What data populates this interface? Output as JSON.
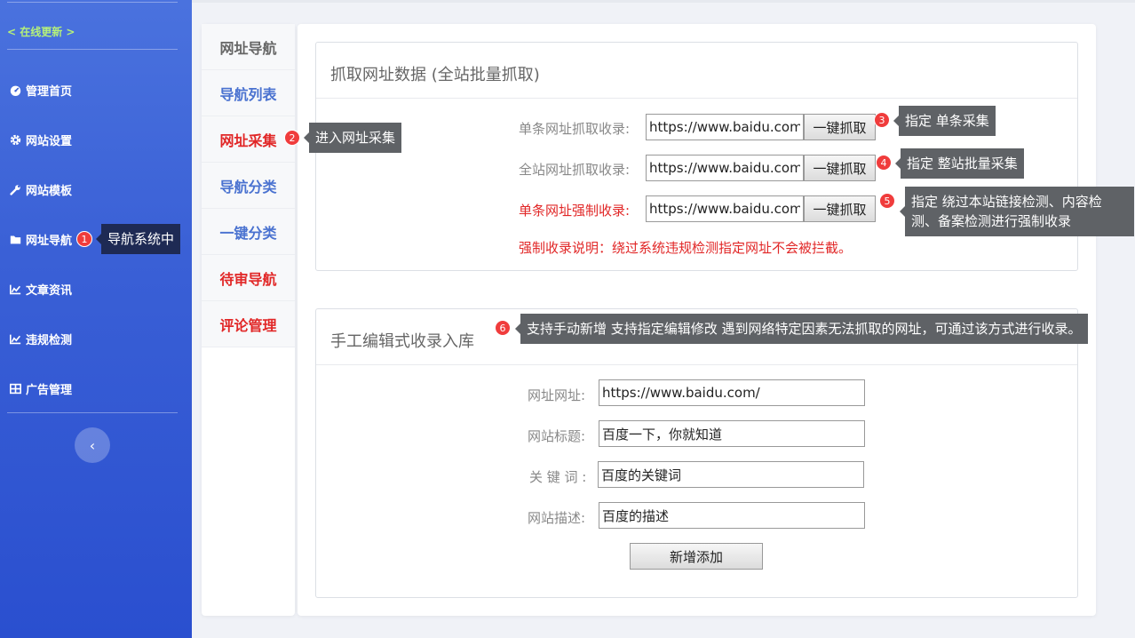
{
  "sidebar": {
    "update_link": "< 在线更新 >",
    "items": [
      {
        "label": "管理首页",
        "icon": "dashboard-icon"
      },
      {
        "label": "网站设置",
        "icon": "gear-icon"
      },
      {
        "label": "网站模板",
        "icon": "wrench-icon"
      },
      {
        "label": "网址导航",
        "icon": "folder-icon"
      },
      {
        "label": "文章资讯",
        "icon": "chart-icon"
      },
      {
        "label": "违规检测",
        "icon": "chart-icon"
      },
      {
        "label": "广告管理",
        "icon": "grid-icon"
      }
    ],
    "collapse_glyph": "‹"
  },
  "annotations": [
    {
      "num": "1",
      "text": "导航系统中"
    },
    {
      "num": "2",
      "text": "进入网址采集"
    },
    {
      "num": "3",
      "text": "指定 单条采集"
    },
    {
      "num": "4",
      "text": "指定 整站批量采集"
    },
    {
      "num": "5",
      "text_line1": "指定 绕过本站链接检测、内容检",
      "text_line2": "测、备案检测进行强制收录"
    },
    {
      "num": "6",
      "text": "支持手动新增 支持指定编辑修改 遇到网络特定因素无法抓取的网址，可通过该方式进行收录。"
    }
  ],
  "subnav": {
    "items": [
      {
        "label": "网址导航"
      },
      {
        "label": "导航列表"
      },
      {
        "label": "网址采集"
      },
      {
        "label": "导航分类"
      },
      {
        "label": "一键分类"
      },
      {
        "label": "待审导航"
      },
      {
        "label": "评论管理"
      }
    ]
  },
  "crawl": {
    "title": "抓取网址数据 (全站批量抓取)",
    "rows": [
      {
        "label": "单条网址抓取收录:",
        "value": "https://www.baidu.com/",
        "button": "一键抓取"
      },
      {
        "label": "全站网址抓取收录:",
        "value": "https://www.baidu.com/",
        "button": "一键抓取"
      },
      {
        "label": "单条网址强制收录:",
        "value": "https://www.baidu.com/",
        "button": "一键抓取"
      }
    ],
    "note": "强制收录说明：绕过系统违规检测指定网址不会被拦截。"
  },
  "manual": {
    "title": "手工编辑式收录入库",
    "fields": [
      {
        "label": "网址网址:",
        "value": "https://www.baidu.com/"
      },
      {
        "label": "网站标题:",
        "value": "百度一下，你就知道"
      },
      {
        "label": "关 键 词 :",
        "value": "百度的关键词"
      },
      {
        "label": "网站描述:",
        "value": "百度的描述"
      }
    ],
    "submit": "新增添加"
  },
  "colors": {
    "sidebar_top": "#4a72de",
    "sidebar_bottom": "#2a4fcf",
    "accent_red": "#e12727",
    "link_blue": "#4a72d0",
    "update_green": "#b5f07a"
  }
}
